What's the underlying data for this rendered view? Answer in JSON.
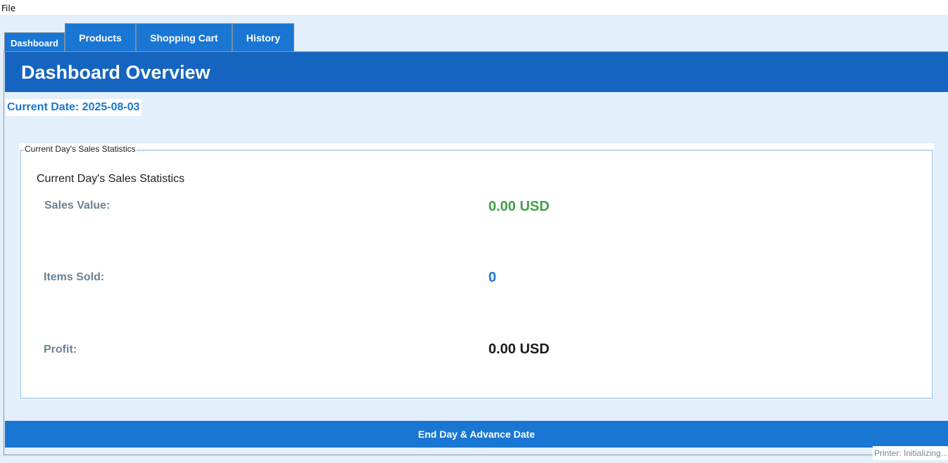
{
  "menubar": {
    "items": [
      "File"
    ]
  },
  "tabs": [
    {
      "label": "Dashboard",
      "active": true
    },
    {
      "label": "Products",
      "active": false
    },
    {
      "label": "Shopping Cart",
      "active": false
    },
    {
      "label": "History",
      "active": false
    }
  ],
  "header": {
    "title": "Dashboard Overview"
  },
  "current_date": "Current Date: 2025-08-03",
  "stats": {
    "legend": "Current Day's Sales Statistics",
    "title": "Current Day's Sales Statistics",
    "rows": [
      {
        "label": "Sales Value:",
        "value": "0.00 USD",
        "color": "#43a047"
      },
      {
        "label": "Items Sold:",
        "value": "0",
        "color": "#1976d2"
      },
      {
        "label": "Profit:",
        "value": "0.00 USD",
        "color": "#1b1b1b"
      }
    ]
  },
  "actions": {
    "end_day_label": "End Day & Advance Date"
  },
  "status": {
    "printer": "Printer: Initializing..."
  },
  "colors": {
    "header_bg": "#1565c0",
    "tab_bg": "#1976d2",
    "page_bg": "#e3f0fb"
  }
}
